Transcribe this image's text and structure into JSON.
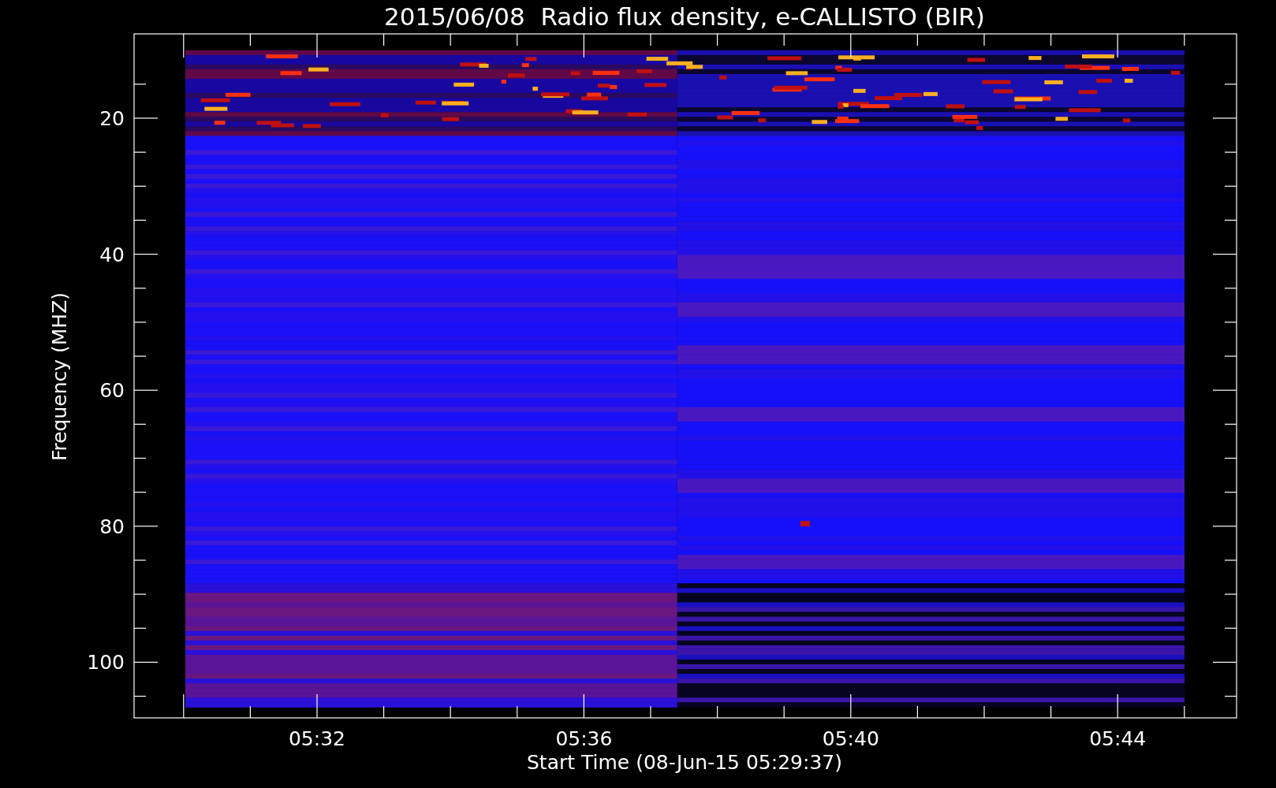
{
  "title": "2015/06/08  Radio flux density, e-CALLISTO (BIR)",
  "y_axis": {
    "label": "Frequency (MHZ)",
    "ticks": [
      "20",
      "40",
      "60",
      "80",
      "100"
    ]
  },
  "x_axis": {
    "label": "Start Time (08-Jun-15 05:29:37)",
    "ticks": [
      "05:32",
      "05:36",
      "05:40",
      "05:44"
    ]
  }
}
